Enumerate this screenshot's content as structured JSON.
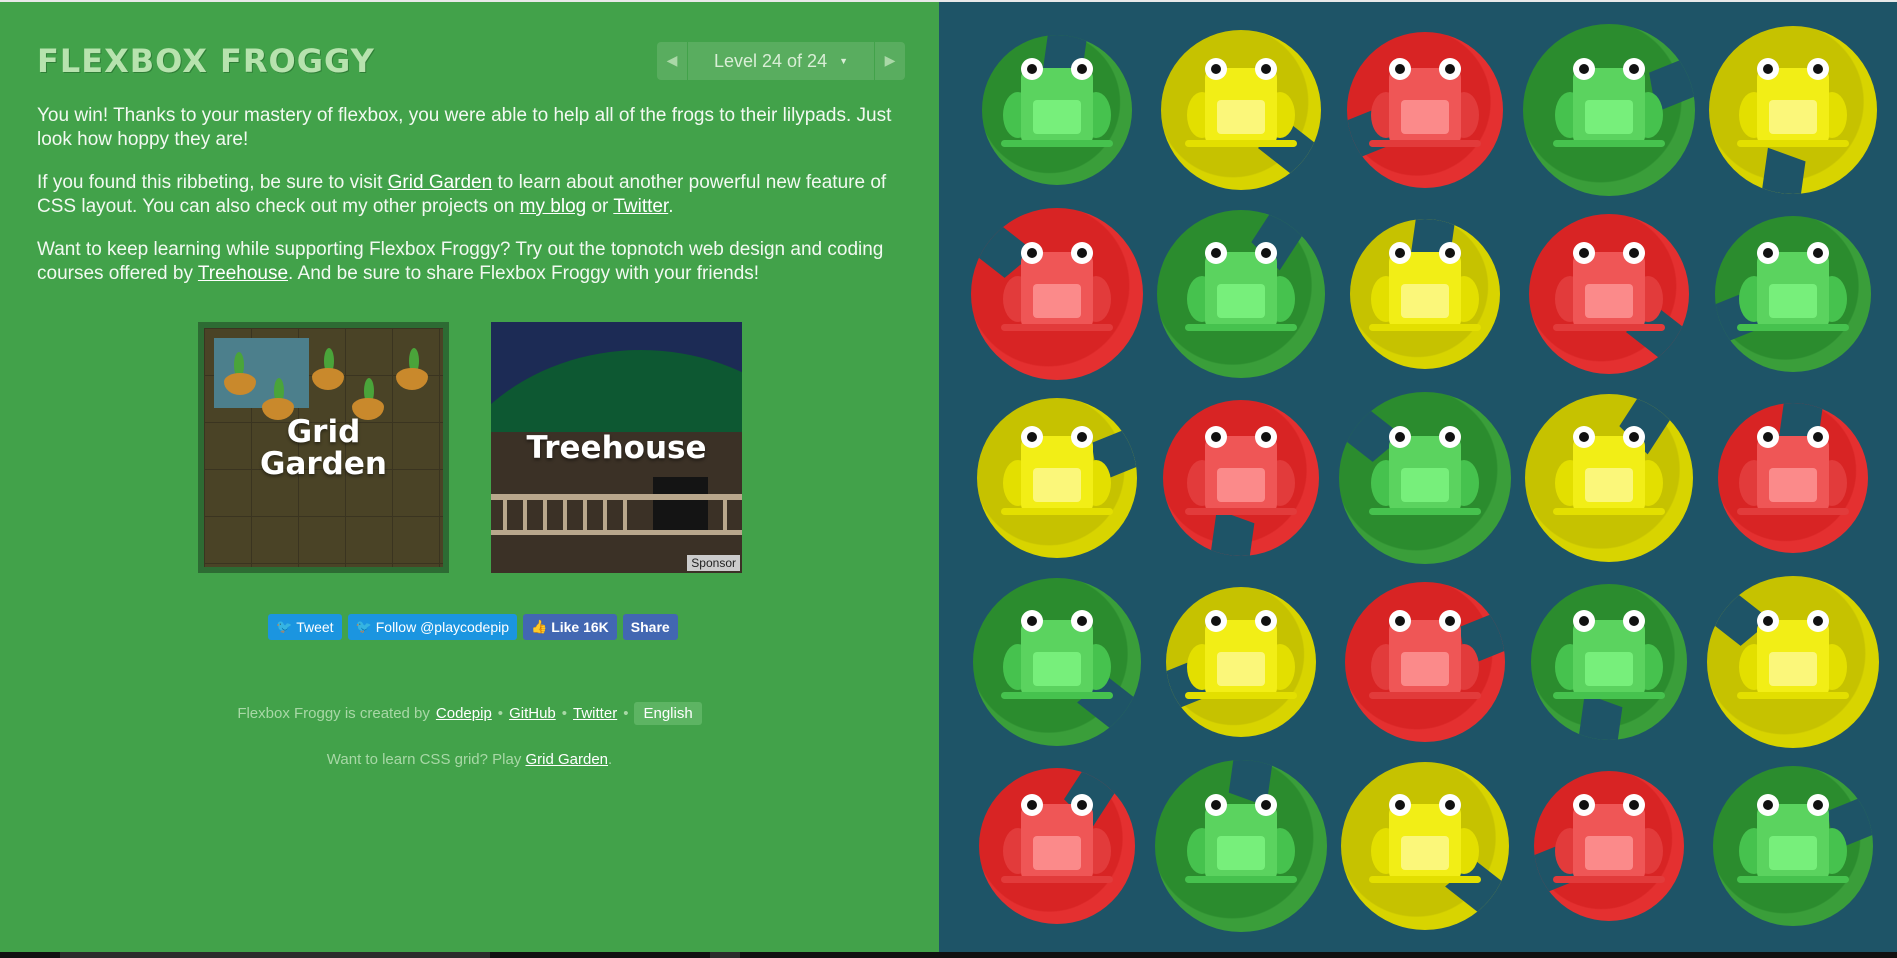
{
  "header": {
    "title": "FLEXBOX FROGGY",
    "level_label": "Level 24 of 24",
    "caret": "▼",
    "prev": "◀",
    "next": "▶"
  },
  "content": {
    "p1": "You win! Thanks to your mastery of flexbox, you were able to help all of the frogs to their lilypads. Just look how hoppy they are!",
    "p2_a": "If you found this ribbeting, be sure to visit ",
    "p2_link1": "Grid Garden",
    "p2_b": " to learn about another powerful new feature of CSS layout. You can also check out my other projects on ",
    "p2_link2": "my blog",
    "p2_c": " or ",
    "p2_link3": "Twitter",
    "p2_d": ".",
    "p3_a": "Want to keep learning while supporting Flexbox Froggy? Try out the topnotch web design and coding courses offered by ",
    "p3_link": "Treehouse",
    "p3_b": ". And be sure to share Flexbox Froggy with your friends!"
  },
  "promos": {
    "grid_garden_line1": "Grid",
    "grid_garden_line2": "Garden",
    "treehouse": "Treehouse",
    "sponsor": "Sponsor"
  },
  "share": {
    "tweet": "Tweet",
    "follow": "Follow @playcodepip",
    "like": "Like 16K",
    "share": "Share"
  },
  "footer": {
    "created_by": "Flexbox Froggy is created by",
    "codepip": "Codepip",
    "sep": "•",
    "github": "GitHub",
    "twitter": "Twitter",
    "language": "English",
    "learn_a": "Want to learn CSS grid? Play",
    "learn_link": "Grid Garden",
    "learn_b": "."
  },
  "board": {
    "colors": {
      "green": "#2b8c2e",
      "yellow": "#c6c200",
      "red": "#d82424",
      "background": "#1e5467"
    },
    "grid": [
      [
        "green",
        "yellow",
        "red",
        "green",
        "yellow"
      ],
      [
        "red",
        "green",
        "yellow",
        "red",
        "green"
      ],
      [
        "yellow",
        "red",
        "green",
        "yellow",
        "red"
      ],
      [
        "green",
        "yellow",
        "red",
        "green",
        "yellow"
      ],
      [
        "red",
        "green",
        "yellow",
        "red",
        "green"
      ]
    ]
  }
}
